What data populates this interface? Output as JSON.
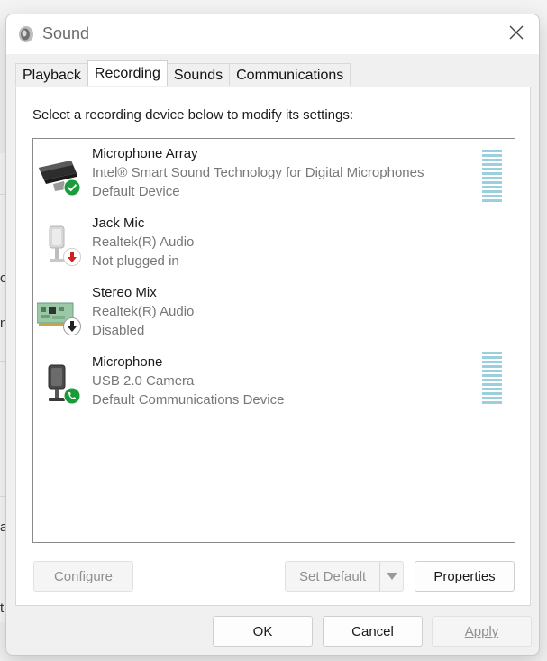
{
  "window": {
    "title": "Sound",
    "title_icon": "speaker-icon"
  },
  "tabs": [
    {
      "label": "Playback",
      "active": false
    },
    {
      "label": "Recording",
      "active": true
    },
    {
      "label": "Sounds",
      "active": false
    },
    {
      "label": "Communications",
      "active": false
    }
  ],
  "recording": {
    "instruction": "Select a recording device below to modify its settings:",
    "devices": [
      {
        "name": "Microphone Array",
        "driver": "Intel® Smart Sound Technology for Digital Microphones",
        "status": "Default Device",
        "icon": "microphone-array-icon",
        "badge": "green-check-badge",
        "meter": true
      },
      {
        "name": "Jack Mic",
        "driver": "Realtek(R) Audio",
        "status": "Not plugged in",
        "icon": "microphone-icon",
        "badge": "red-down-arrow-badge",
        "meter": false
      },
      {
        "name": "Stereo Mix",
        "driver": "Realtek(R) Audio",
        "status": "Disabled",
        "icon": "sound-card-icon",
        "badge": "black-down-arrow-badge",
        "meter": false
      },
      {
        "name": "Microphone",
        "driver": "USB 2.0 Camera",
        "status": "Default Communications Device",
        "icon": "microphone-icon",
        "badge": "green-phone-badge",
        "meter": true
      }
    ],
    "buttons": {
      "configure": "Configure",
      "set_default": "Set Default",
      "properties": "Properties"
    }
  },
  "dialog_buttons": {
    "ok": "OK",
    "cancel": "Cancel",
    "apply": "Apply"
  },
  "background": {
    "chars": [
      "c",
      "n",
      "a",
      "ti"
    ]
  },
  "colors": {
    "accent_green": "#1a9c3a",
    "alert_red": "#d21f1f",
    "meter": "#9ccfdd"
  }
}
